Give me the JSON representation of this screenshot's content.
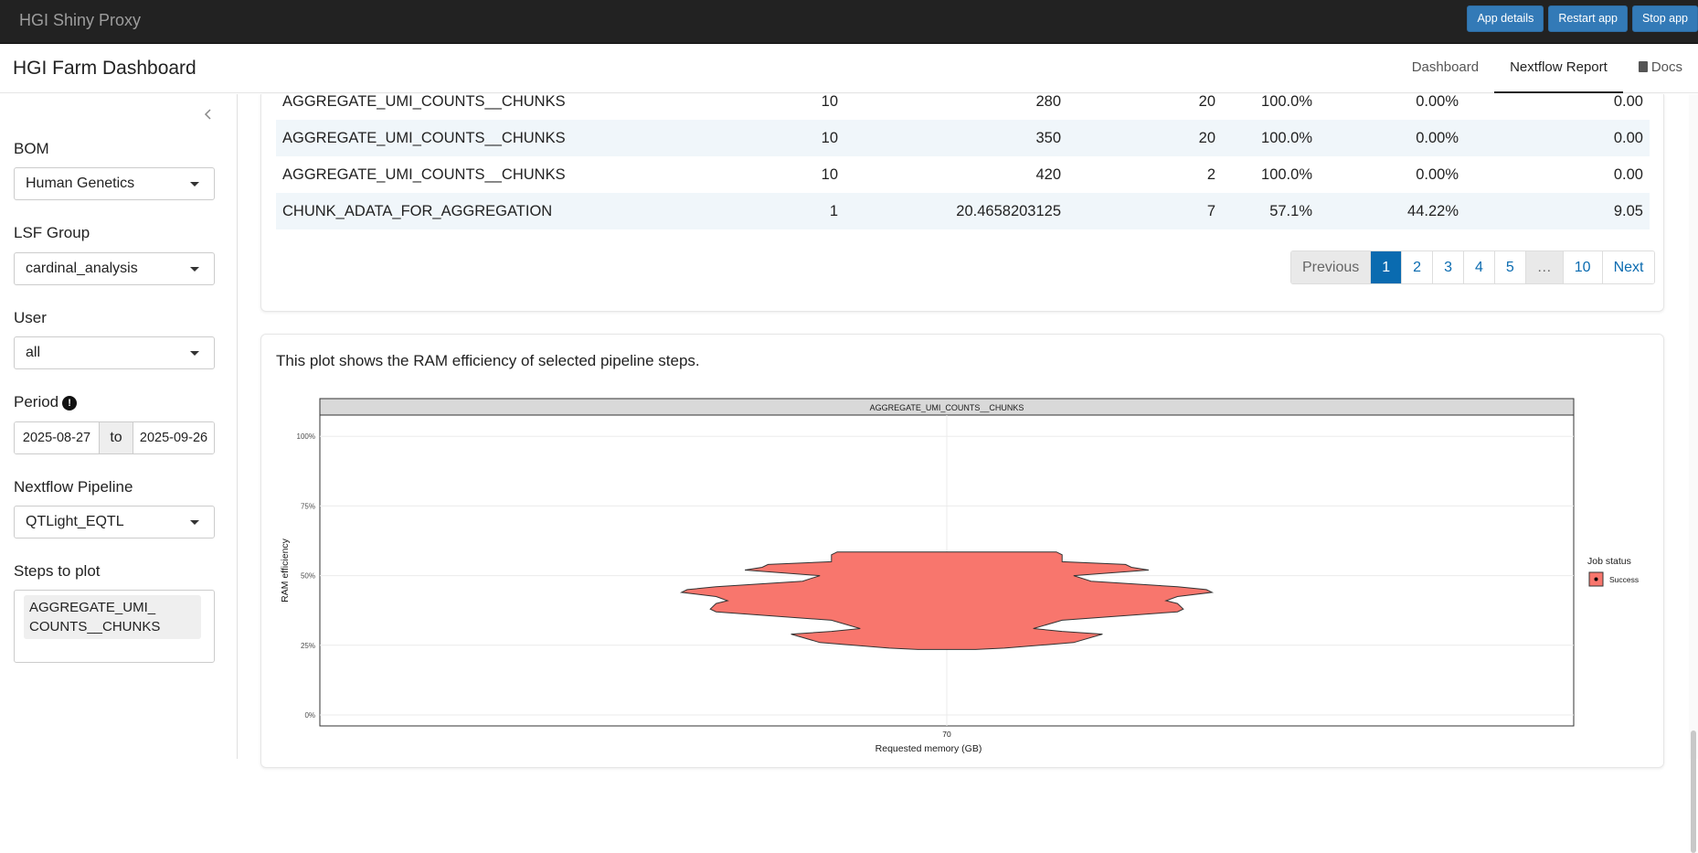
{
  "topbar": {
    "brand": "HGI Shiny Proxy",
    "buttons": [
      "App details",
      "Restart app",
      "Stop app"
    ]
  },
  "navbar": {
    "title": "HGI Farm Dashboard",
    "links": [
      "Dashboard",
      "Nextflow Report",
      "Docs"
    ],
    "active": "Nextflow Report"
  },
  "sidebar": {
    "bom": {
      "label": "BOM",
      "value": "Human Genetics"
    },
    "lsf_group": {
      "label": "LSF Group",
      "value": "cardinal_analysis"
    },
    "user": {
      "label": "User",
      "value": "all"
    },
    "period": {
      "label": "Period",
      "info": "!",
      "start": "2025-08-27",
      "to": "to",
      "end": "2025-09-26"
    },
    "pipeline": {
      "label": "Nextflow Pipeline",
      "value": "QTLight_EQTL"
    },
    "steps": {
      "label": "Steps to plot",
      "selected": "AGGREGATE_UMI_ COUNTS__CHUNKS"
    }
  },
  "table": {
    "rows": [
      [
        "AGGREGATE_UMI_COUNTS__CHUNKS",
        "10",
        "280",
        "20",
        "100.0%",
        "0.00%",
        "0.00"
      ],
      [
        "AGGREGATE_UMI_COUNTS__CHUNKS",
        "10",
        "350",
        "20",
        "100.0%",
        "0.00%",
        "0.00"
      ],
      [
        "AGGREGATE_UMI_COUNTS__CHUNKS",
        "10",
        "420",
        "2",
        "100.0%",
        "0.00%",
        "0.00"
      ],
      [
        "CHUNK_ADATA_FOR_AGGREGATION",
        "1",
        "20.4658203125",
        "7",
        "57.1%",
        "44.22%",
        "9.05"
      ]
    ]
  },
  "pagination": {
    "items": [
      "Previous",
      "1",
      "2",
      "3",
      "4",
      "5",
      "…",
      "10",
      "Next"
    ],
    "active": "1"
  },
  "plot_section": {
    "description": "This plot shows the RAM efficiency of selected pipeline steps."
  },
  "chart_data": {
    "type": "violin",
    "facet_title": "AGGREGATE_UMI_COUNTS__CHUNKS",
    "xlabel": "Requested memory (GB)",
    "ylabel": "RAM efficiency",
    "x_ticks": [
      "70"
    ],
    "y_ticks": [
      "0%",
      "25%",
      "50%",
      "75%",
      "100%"
    ],
    "ylim": [
      0,
      1.05
    ],
    "grid": true,
    "legend": {
      "title": "Job status",
      "position": "right",
      "entries": [
        {
          "name": "Success",
          "color": "#F8766D"
        }
      ]
    },
    "series": [
      {
        "name": "Success",
        "x": 70,
        "color": "#F8766D",
        "density_profile": [
          [
            0.235,
            0.05
          ],
          [
            0.24,
            0.1
          ],
          [
            0.26,
            0.22
          ],
          [
            0.29,
            0.27
          ],
          [
            0.3,
            0.2
          ],
          [
            0.31,
            0.15
          ],
          [
            0.34,
            0.2
          ],
          [
            0.37,
            0.4
          ],
          [
            0.38,
            0.41
          ],
          [
            0.4,
            0.4
          ],
          [
            0.41,
            0.38
          ],
          [
            0.425,
            0.4
          ],
          [
            0.44,
            0.46
          ],
          [
            0.45,
            0.45
          ],
          [
            0.46,
            0.4
          ],
          [
            0.48,
            0.25
          ],
          [
            0.5,
            0.22
          ],
          [
            0.52,
            0.35
          ],
          [
            0.53,
            0.32
          ],
          [
            0.54,
            0.31
          ],
          [
            0.55,
            0.2
          ],
          [
            0.575,
            0.2
          ],
          [
            0.585,
            0.19
          ]
        ]
      }
    ]
  }
}
